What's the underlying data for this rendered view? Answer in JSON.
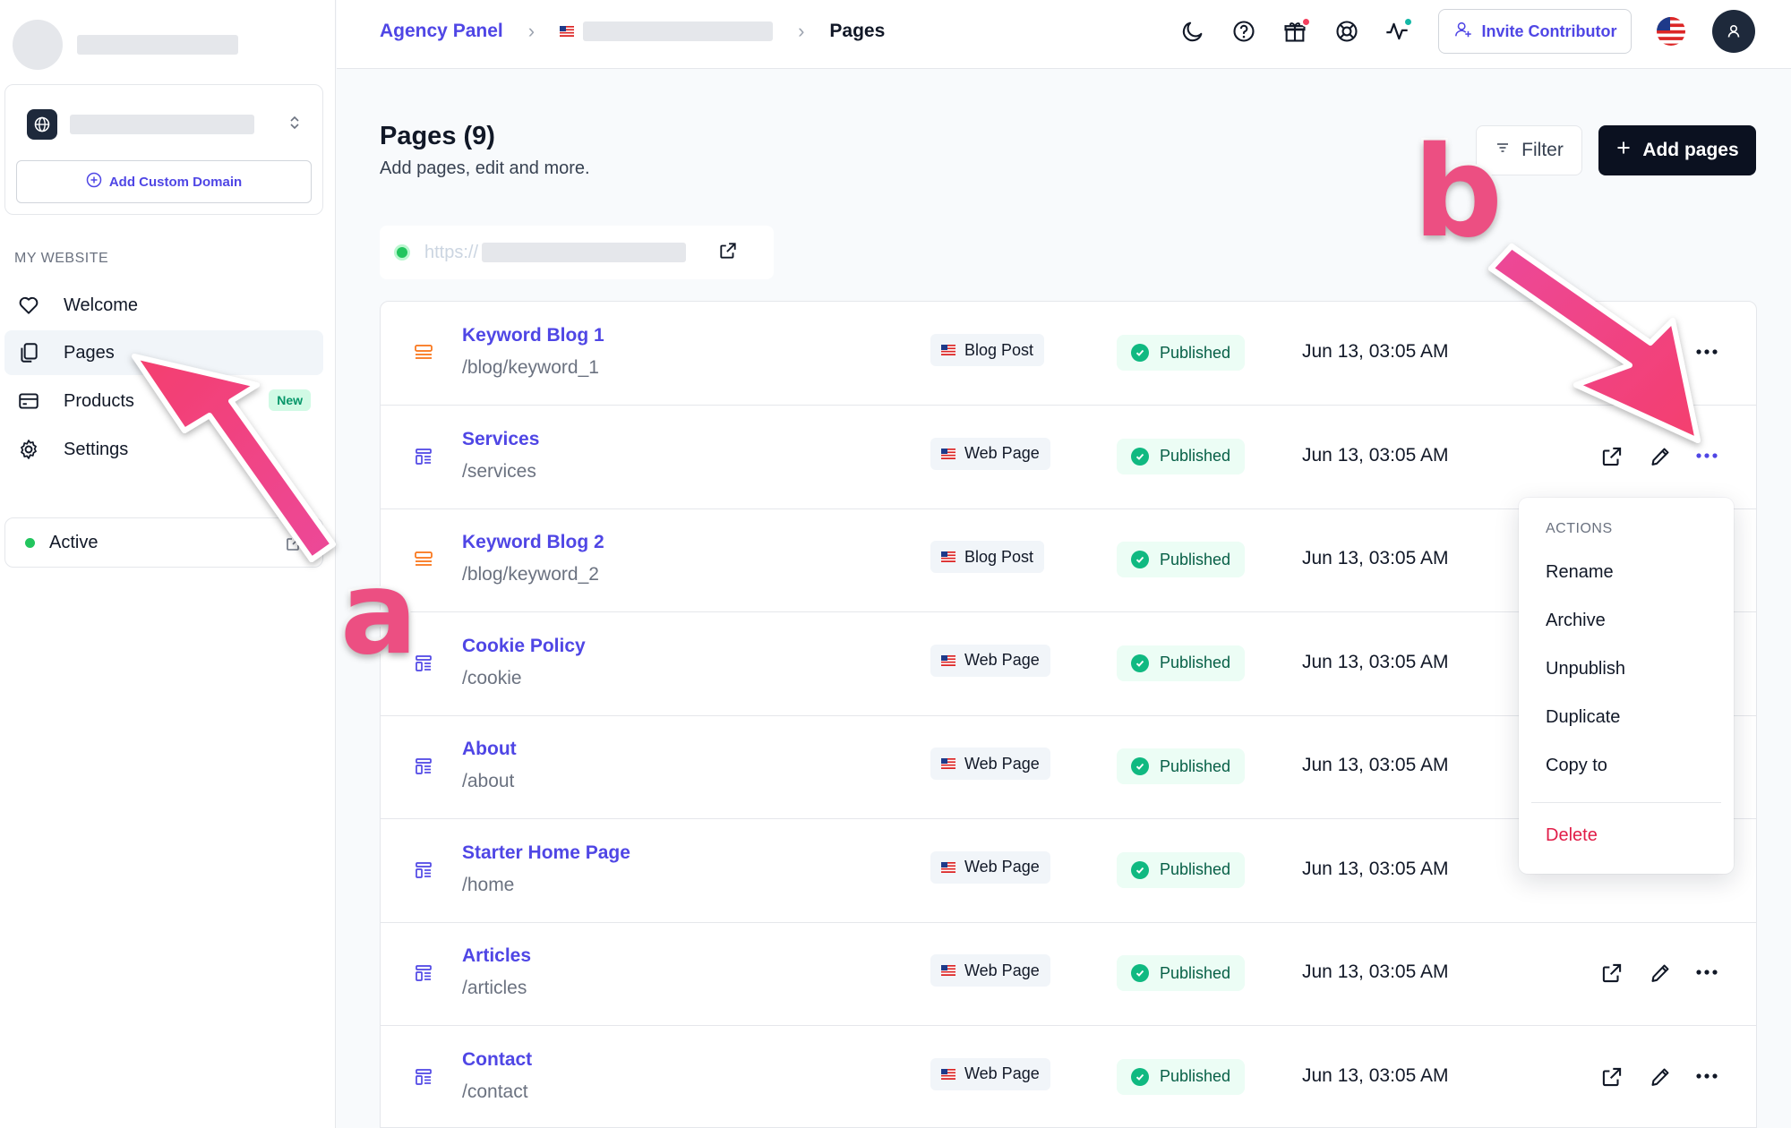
{
  "sidebar": {
    "add_domain_label": "Add Custom Domain",
    "section_label": "MY WEBSITE",
    "items": [
      {
        "label": "Welcome",
        "icon": "heart-icon"
      },
      {
        "label": "Pages",
        "icon": "pages-icon",
        "active": true
      },
      {
        "label": "Products",
        "icon": "card-icon",
        "badge": "New"
      },
      {
        "label": "Settings",
        "icon": "gear-icon"
      }
    ],
    "status_label": "Active"
  },
  "topbar": {
    "breadcrumb_root": "Agency Panel",
    "breadcrumb_current": "Pages",
    "invite_label": "Invite Contributor"
  },
  "main": {
    "title": "Pages (9)",
    "subtitle": "Add pages, edit and more.",
    "filter_label": "Filter",
    "add_label": "Add pages",
    "url_prefix": "https://"
  },
  "rows": [
    {
      "title": "Keyword Blog 1",
      "path": "/blog/keyword_1",
      "type": "Blog Post",
      "status": "Published",
      "date": "Jun 13, 03:05 AM",
      "icon": "blog-post-icon"
    },
    {
      "title": "Services",
      "path": "/services",
      "type": "Web Page",
      "status": "Published",
      "date": "Jun 13, 03:05 AM",
      "icon": "web-page-icon"
    },
    {
      "title": "Keyword Blog 2",
      "path": "/blog/keyword_2",
      "type": "Blog Post",
      "status": "Published",
      "date": "Jun 13, 03:05 AM",
      "icon": "blog-post-icon"
    },
    {
      "title": "Cookie Policy",
      "path": "/cookie",
      "type": "Web Page",
      "status": "Published",
      "date": "Jun 13, 03:05 AM",
      "icon": "web-page-icon"
    },
    {
      "title": "About",
      "path": "/about",
      "type": "Web Page",
      "status": "Published",
      "date": "Jun 13, 03:05 AM",
      "icon": "web-page-icon"
    },
    {
      "title": "Starter Home Page",
      "path": "/home",
      "type": "Web Page",
      "status": "Published",
      "date": "Jun 13, 03:05 AM",
      "icon": "web-page-icon"
    },
    {
      "title": "Articles",
      "path": "/articles",
      "type": "Web Page",
      "status": "Published",
      "date": "Jun 13, 03:05 AM",
      "icon": "web-page-icon"
    },
    {
      "title": "Contact",
      "path": "/contact",
      "type": "Web Page",
      "status": "Published",
      "date": "Jun 13, 03:05 AM",
      "icon": "web-page-icon"
    }
  ],
  "dropdown": {
    "label": "ACTIONS",
    "items": [
      "Rename",
      "Archive",
      "Unpublish",
      "Duplicate",
      "Copy to"
    ],
    "delete_label": "Delete"
  },
  "annotations": {
    "a": "a",
    "b": "b"
  },
  "colors": {
    "accent": "#4f46e5",
    "annotation": "#ec4f82",
    "published_bg": "#ecfdf5",
    "published_check": "#10b981",
    "delete": "#e11d48",
    "blog_icon": "#f97316"
  }
}
